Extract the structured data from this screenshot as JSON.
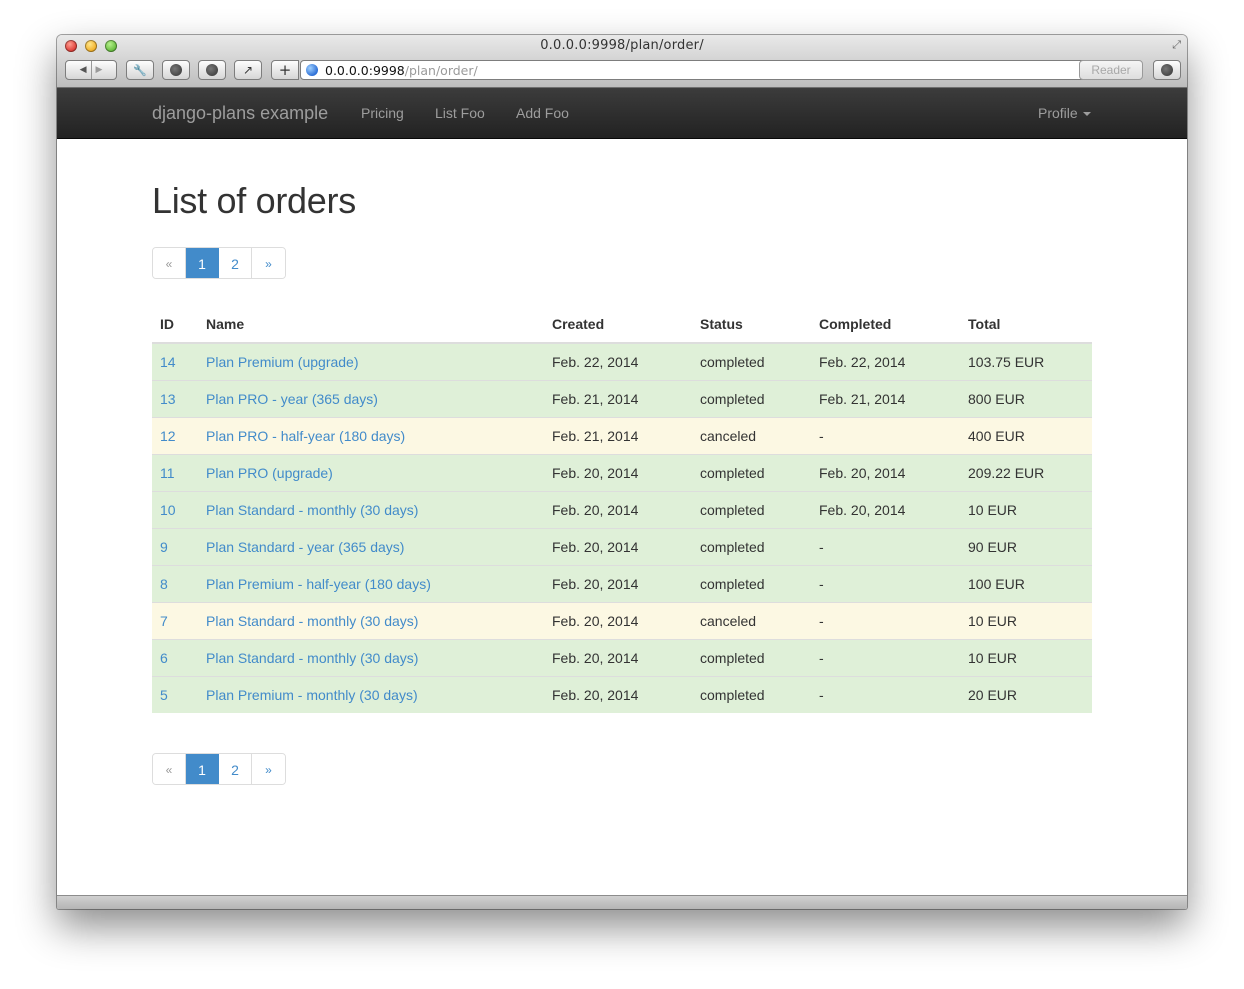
{
  "window": {
    "title": "0.0.0.0:9998/plan/order/"
  },
  "toolbar": {
    "back_icon": "◀",
    "forward_icon": "▶",
    "add_bookmark_icon": "+",
    "url_host": "0.0.0.0:9998",
    "url_path": "/plan/order/",
    "reload_icon": "↻",
    "reader_label": "Reader"
  },
  "navbar": {
    "brand": "django-plans example",
    "links": [
      "Pricing",
      "List Foo",
      "Add Foo"
    ],
    "profile": "Profile"
  },
  "page": {
    "title": "List of orders"
  },
  "pagination": {
    "prev": "«",
    "pages": [
      "1",
      "2"
    ],
    "active_page": "1",
    "next": "»"
  },
  "table": {
    "columns": [
      "ID",
      "Name",
      "Created",
      "Status",
      "Completed",
      "Total"
    ],
    "rows": [
      {
        "id": "14",
        "name": "Plan Premium (upgrade)",
        "created": "Feb. 22, 2014",
        "status": "completed",
        "completed": "Feb. 22, 2014",
        "total": "103.75 EUR",
        "state": "success"
      },
      {
        "id": "13",
        "name": "Plan PRO - year (365 days)",
        "created": "Feb. 21, 2014",
        "status": "completed",
        "completed": "Feb. 21, 2014",
        "total": "800 EUR",
        "state": "success"
      },
      {
        "id": "12",
        "name": "Plan PRO - half-year (180 days)",
        "created": "Feb. 21, 2014",
        "status": "canceled",
        "completed": "-",
        "total": "400 EUR",
        "state": "warning"
      },
      {
        "id": "11",
        "name": "Plan PRO (upgrade)",
        "created": "Feb. 20, 2014",
        "status": "completed",
        "completed": "Feb. 20, 2014",
        "total": "209.22 EUR",
        "state": "success"
      },
      {
        "id": "10",
        "name": "Plan Standard - monthly (30 days)",
        "created": "Feb. 20, 2014",
        "status": "completed",
        "completed": "Feb. 20, 2014",
        "total": "10 EUR",
        "state": "success"
      },
      {
        "id": "9",
        "name": "Plan Standard - year (365 days)",
        "created": "Feb. 20, 2014",
        "status": "completed",
        "completed": "-",
        "total": "90 EUR",
        "state": "success"
      },
      {
        "id": "8",
        "name": "Plan Premium - half-year (180 days)",
        "created": "Feb. 20, 2014",
        "status": "completed",
        "completed": "-",
        "total": "100 EUR",
        "state": "success"
      },
      {
        "id": "7",
        "name": "Plan Standard - monthly (30 days)",
        "created": "Feb. 20, 2014",
        "status": "canceled",
        "completed": "-",
        "total": "10 EUR",
        "state": "warning"
      },
      {
        "id": "6",
        "name": "Plan Standard - monthly (30 days)",
        "created": "Feb. 20, 2014",
        "status": "completed",
        "completed": "-",
        "total": "10 EUR",
        "state": "success"
      },
      {
        "id": "5",
        "name": "Plan Premium - monthly (30 days)",
        "created": "Feb. 20, 2014",
        "status": "completed",
        "completed": "-",
        "total": "20 EUR",
        "state": "success"
      }
    ]
  },
  "colors": {
    "link": "#428bca",
    "success_row": "#dff0d8",
    "warning_row": "#fcf8e3",
    "navbar": "#222222"
  }
}
